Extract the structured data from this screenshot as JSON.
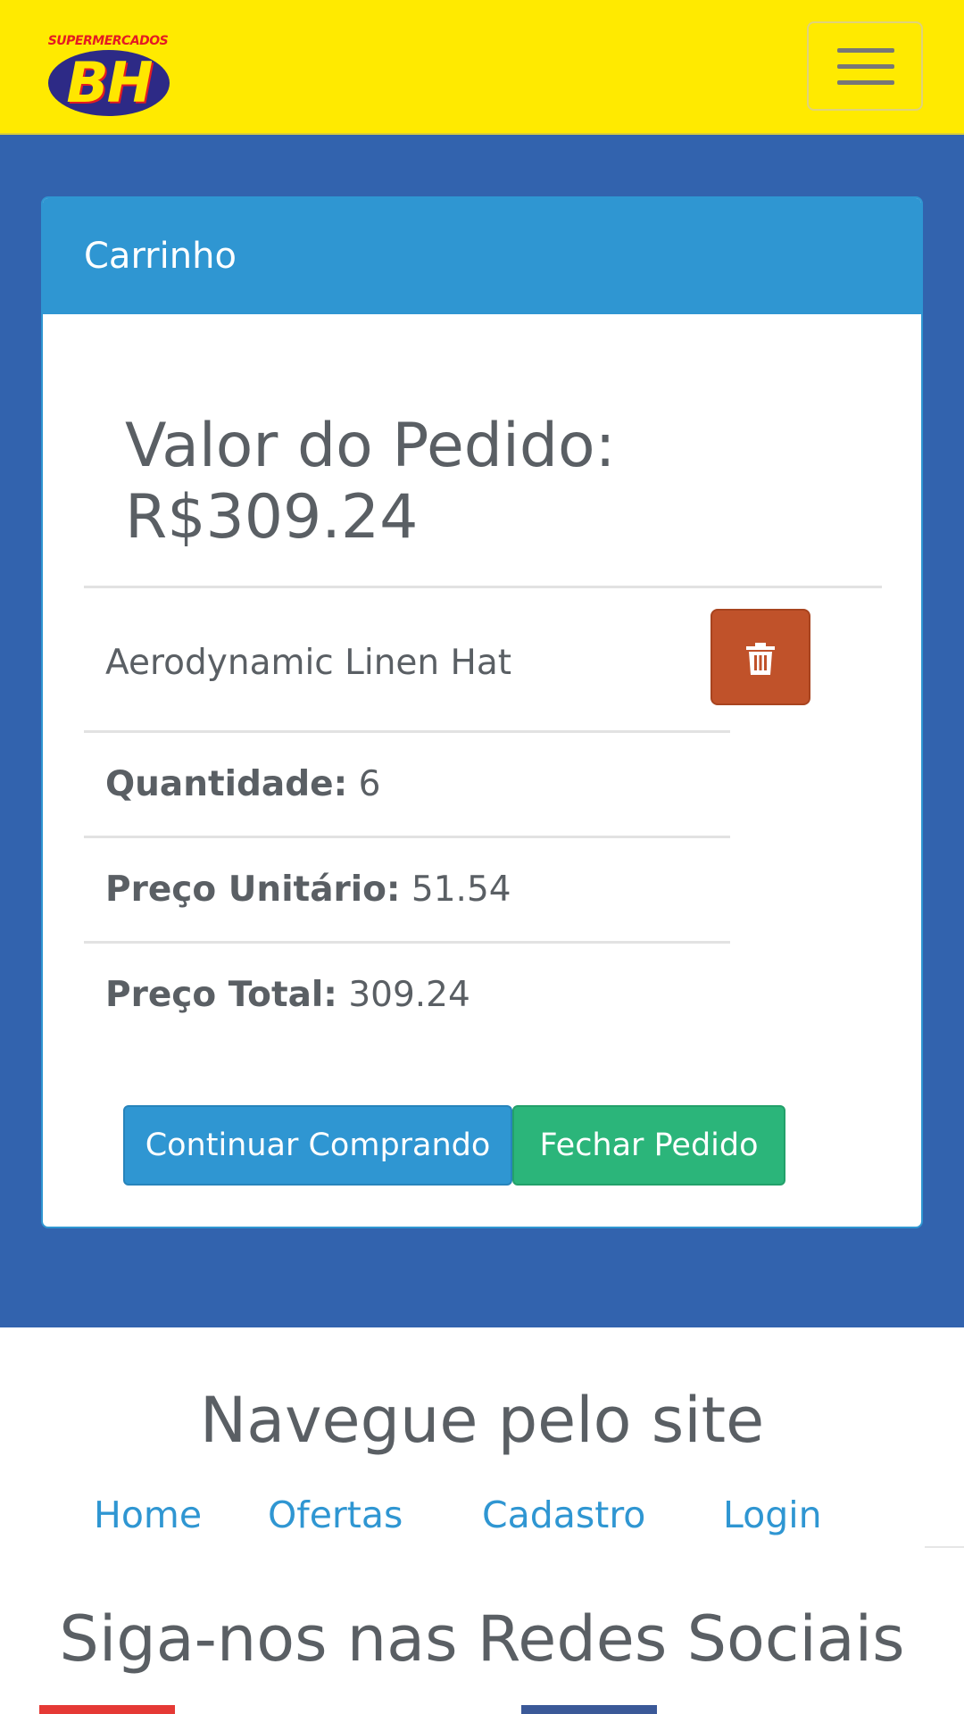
{
  "header": {
    "logo": {
      "top_text": "SUPERMERCADOS",
      "brand": "BH"
    },
    "menu_button": {
      "icon": "hamburger-icon"
    }
  },
  "cart": {
    "title": "Carrinho",
    "order_value_label": "Valor do Pedido:",
    "order_value": "R$309.24",
    "item": {
      "name": "Aerodynamic Linen Hat",
      "quantity_label": "Quantidade:",
      "quantity": "6",
      "unit_price_label": "Preço Unitário:",
      "unit_price": "51.54",
      "total_price_label": "Preço Total:",
      "total_price": "309.24",
      "delete_icon": "trash-icon"
    },
    "buttons": {
      "continue": "Continuar Comprando",
      "close": "Fechar Pedido"
    }
  },
  "footer": {
    "nav_title": "Navegue pelo site",
    "nav_links": [
      "Home",
      "Ofertas",
      "Cadastro",
      "Login"
    ],
    "social_title": "Siga-nos nas Redes Sociais"
  },
  "colors": {
    "header_bg": "#ffea00",
    "page_blue": "#3263ae",
    "panel_accent": "#2f96d2",
    "delete_red": "#c0522a",
    "close_green": "#2bb57a"
  }
}
